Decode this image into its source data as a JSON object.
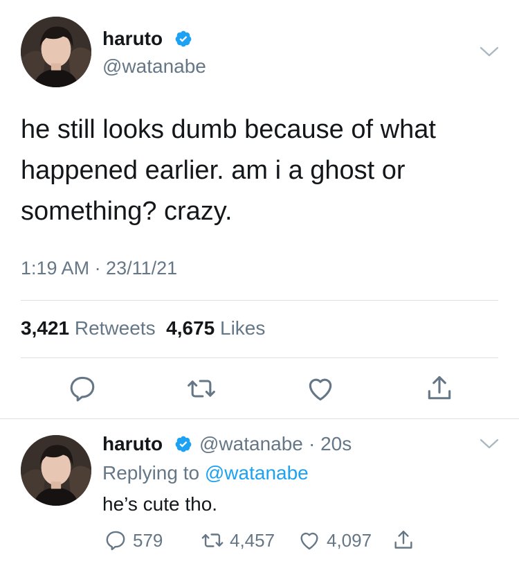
{
  "main_tweet": {
    "display_name": "haruto",
    "handle": "@watanabe",
    "text": "he still looks dumb because of what happened earlier. am i a ghost or something? crazy.",
    "timestamp": "1:19 AM · 23/11/21",
    "retweets_count": "3,421",
    "retweets_label": "Retweets",
    "likes_count": "4,675",
    "likes_label": "Likes"
  },
  "reply_tweet": {
    "display_name": "haruto",
    "handle": "@watanabe",
    "time": "· 20s",
    "replying_prefix": "Replying to",
    "replying_to": "@watanabe",
    "text": "he’s cute tho.",
    "reply_count": "579",
    "retweet_count": "4,457",
    "like_count": "4,097"
  },
  "colors": {
    "text": "#14171a",
    "secondary": "#657786",
    "link": "#1da1f2",
    "divider": "#d9dfe3"
  },
  "icons": {
    "verified": "verified-badge-icon",
    "chevron": "chevron-down-icon",
    "reply": "reply-icon",
    "retweet": "retweet-icon",
    "like": "heart-icon",
    "share": "share-icon"
  }
}
